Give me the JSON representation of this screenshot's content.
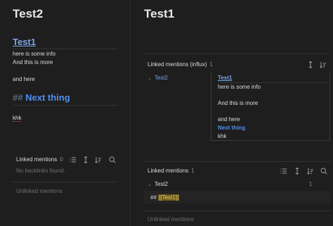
{
  "left": {
    "title": "Test2",
    "link_heading": "Test1",
    "lines": [
      "here is some info",
      "And this is more"
    ],
    "line3": "and here",
    "heading_hash": "##",
    "heading_text": "Next thing",
    "khk": "khk",
    "linked_mentions": {
      "label": "Linked mentions",
      "count": "0",
      "empty": "No backlinks found."
    },
    "unlinked_mentions": "Unlinked mentions"
  },
  "right": {
    "title": "Test1",
    "influx": {
      "label": "Linked mentions (influx)",
      "count": "1",
      "file": "Test2"
    },
    "card": {
      "link": "Test1",
      "line1": "here is some info",
      "line2": "And this is more",
      "line3": "and here",
      "heading": "Next thing",
      "line4": "khk"
    },
    "linked_mentions": {
      "label": "Linked mentions",
      "count": "1",
      "file": "Test2"
    },
    "snippet": {
      "hash": "##",
      "link": "[[Test1]]"
    },
    "unlinked_mentions": "Unlinked mentions"
  },
  "icons": [
    "list-icon",
    "expand-icon",
    "sort-icon",
    "search-icon"
  ],
  "colors": {
    "bg": "#1e1e1e",
    "link": "#79a6e8",
    "heading": "#4c8ff0",
    "muted": "#6f6f6f"
  }
}
